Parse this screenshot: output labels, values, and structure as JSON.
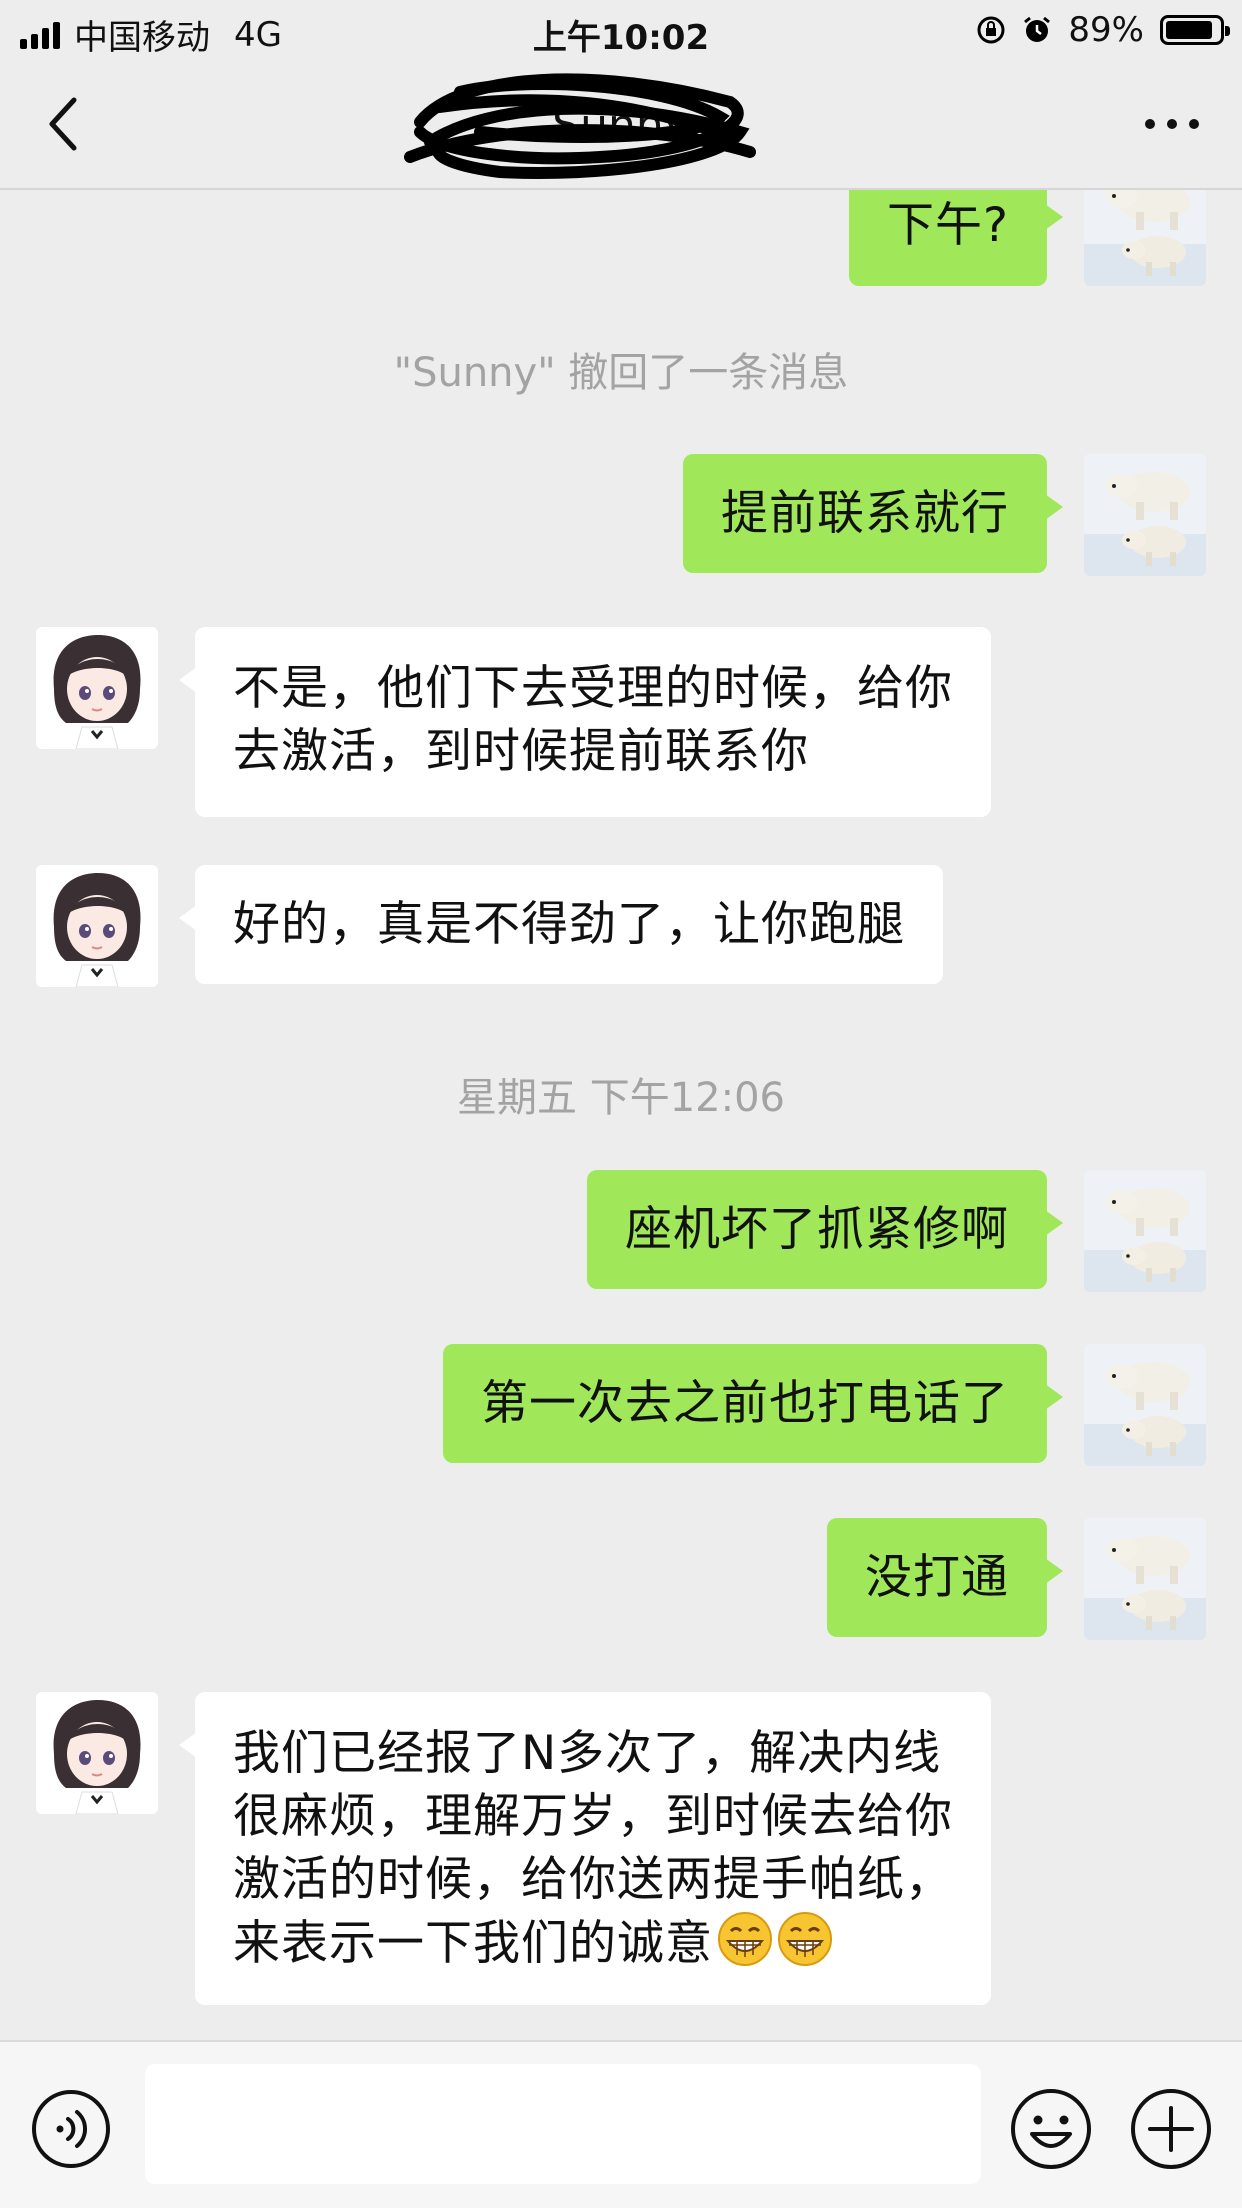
{
  "status_bar": {
    "carrier": "中国移动",
    "network": "4G",
    "time": "上午10:02",
    "battery": "89%",
    "battery_level": 0.89
  },
  "header": {
    "title": "Sunny"
  },
  "messages": [
    {
      "from": "self",
      "text": [
        "下午?"
      ]
    },
    {
      "system": "\"Sunny\" 撤回了一条消息"
    },
    {
      "from": "self",
      "text": [
        "提前联系就行"
      ]
    },
    {
      "from": "other",
      "text": [
        "不是，他们下去受理的时候，给你",
        "去激活，到时候提前联系你"
      ]
    },
    {
      "from": "other",
      "text": [
        "好的，真是不得劲了，让你跑腿"
      ]
    },
    {
      "system": "星期五 下午12:06"
    },
    {
      "from": "self",
      "text": [
        "座机坏了抓紧修啊"
      ]
    },
    {
      "from": "self",
      "text": [
        "第一次去之前也打电话了"
      ]
    },
    {
      "from": "self",
      "text": [
        "没打通"
      ]
    },
    {
      "from": "other",
      "text": [
        "我们已经报了N多次了，解决内线",
        "很麻烦，理解万岁，到时候去给你",
        "激活的时候，给你送两提手帕纸，",
        "来表示一下我们的诚意"
      ],
      "emoji": [
        "grin-emoji",
        "grin-emoji"
      ]
    }
  ],
  "input": {
    "value": "",
    "placeholder": ""
  },
  "colors": {
    "self_bubble": "#a0e75a",
    "other_bubble": "#ffffff",
    "background": "#ededed"
  }
}
